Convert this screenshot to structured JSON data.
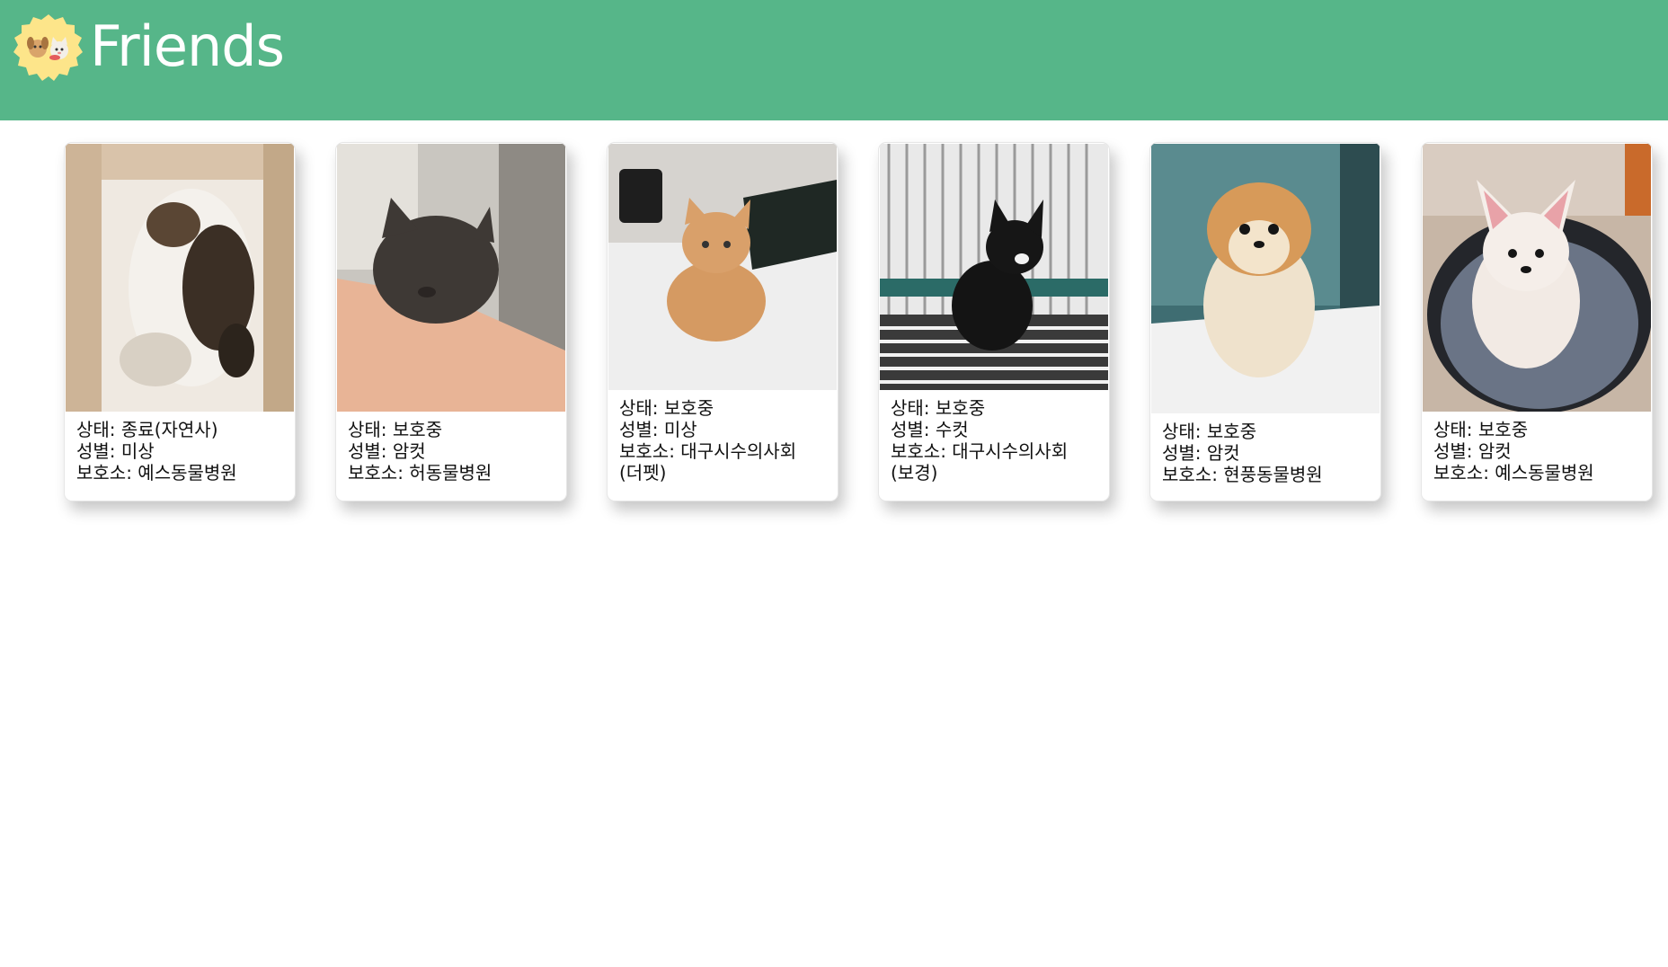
{
  "header": {
    "brand": "Friends",
    "logo_icon": "pets-logo-icon"
  },
  "colors": {
    "header_bg": "#56b689",
    "logo_bg": "#fde58a"
  },
  "cards": [
    {
      "status": "상태: 종료(자연사)",
      "sex": "성별: 미상",
      "shelter": "보호소: 예스동물병원",
      "shelter_cont": ""
    },
    {
      "status": "상태: 보호중",
      "sex": "성별: 암컷",
      "shelter": "보호소: 허동물병원",
      "shelter_cont": ""
    },
    {
      "status": "상태: 보호중",
      "sex": "성별: 미상",
      "shelter": "보호소: 대구시수의사회",
      "shelter_cont": "(더펫)"
    },
    {
      "status": "상태: 보호중",
      "sex": "성별: 수컷",
      "shelter": "보호소: 대구시수의사회",
      "shelter_cont": "(보경)"
    },
    {
      "status": "상태: 보호중",
      "sex": "성별: 암컷",
      "shelter": "보호소: 현풍동물병원",
      "shelter_cont": ""
    },
    {
      "status": "상태: 보호중",
      "sex": "성별: 암컷",
      "shelter": "보호소: 예스동물병원",
      "shelter_cont": ""
    }
  ]
}
